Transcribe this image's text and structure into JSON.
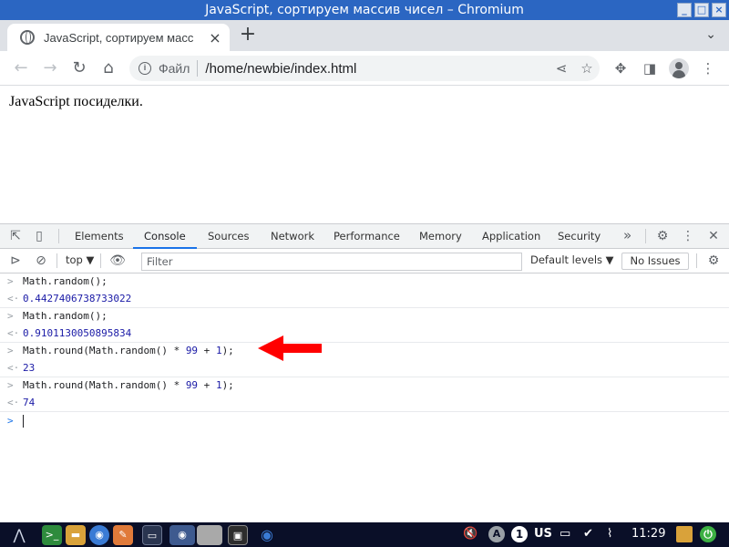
{
  "window": {
    "title": "JavaScript, сортируем массив чисел – Chromium"
  },
  "tab": {
    "title": "JavaScript, сортируем масс"
  },
  "omnibox": {
    "scheme": "Файл",
    "url": "/home/newbie/index.html"
  },
  "page": {
    "text": "JavaScript посиделки."
  },
  "devtools": {
    "tabs": [
      "Elements",
      "Console",
      "Sources",
      "Network",
      "Performance",
      "Memory",
      "Application",
      "Security"
    ],
    "active_tab": "Console",
    "context": "top",
    "filter_placeholder": "Filter",
    "levels": "Default levels",
    "issues": "No Issues"
  },
  "console": {
    "entries": [
      {
        "input_plain": "Math.random();",
        "output": "0.4427406738733022"
      },
      {
        "input_plain": "Math.random();",
        "output": "0.9101130050895834"
      },
      {
        "input_pre": "Math.round(Math.random() * ",
        "input_num1": "99",
        "input_mid": " + ",
        "input_num2": "1",
        "input_post": ");",
        "output": "23"
      },
      {
        "input_pre": "Math.round(Math.random() * ",
        "input_num1": "99",
        "input_mid": " + ",
        "input_num2": "1",
        "input_post": ");",
        "output": "74"
      }
    ]
  },
  "taskbar": {
    "keyboard": "US",
    "clock": "11:29",
    "workspace": "1"
  },
  "colors": {
    "titlebar": "#2b66c2",
    "arrow": "#ff0000",
    "result": "#1a1aa6",
    "active_tab": "#1a73e8"
  }
}
